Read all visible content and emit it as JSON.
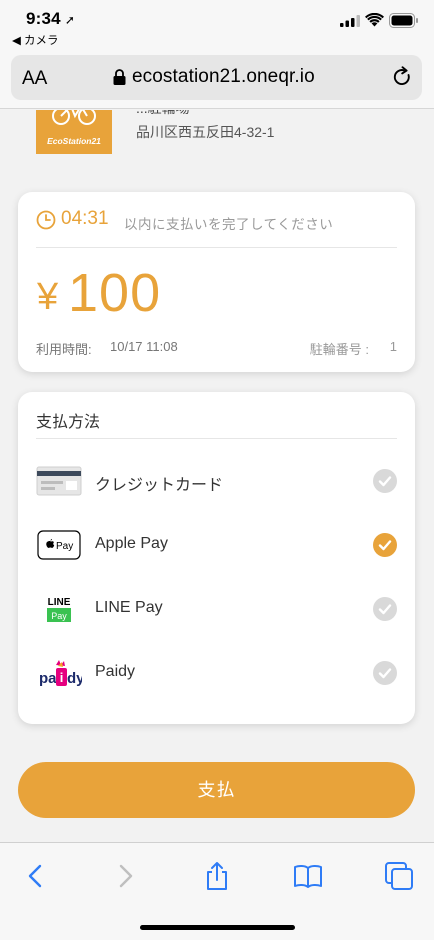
{
  "status": {
    "time": "9:34",
    "back_label": "◀ カメラ"
  },
  "browser": {
    "aa_label": "AA",
    "url": "ecostation21.oneqr.io"
  },
  "station": {
    "logo_text": "EcoStation21",
    "name_partial": "...駐輪場",
    "address": "品川区西五反田4-32-1"
  },
  "payment_info": {
    "timer": "04:31",
    "timer_note": "以内に支払いを完了してください",
    "currency": "¥",
    "amount": "100",
    "usage_label": "利用時間:",
    "usage_time": "10/17 11:08",
    "slot_label": "駐輪番号 :",
    "slot_number": "1"
  },
  "methods": {
    "title": "支払方法",
    "items": [
      {
        "label": "クレジットカード",
        "icon": "credit-card-icon",
        "selected": false
      },
      {
        "label": "Apple Pay",
        "icon": "apple-pay-icon",
        "selected": true
      },
      {
        "label": "LINE Pay",
        "icon": "line-pay-icon",
        "selected": false
      },
      {
        "label": "Paidy",
        "icon": "paidy-icon",
        "selected": false
      }
    ]
  },
  "pay_button": "支払",
  "colors": {
    "accent": "#e8a33a",
    "check_off": "#d9d9d9",
    "link_blue": "#2f7cf6"
  }
}
